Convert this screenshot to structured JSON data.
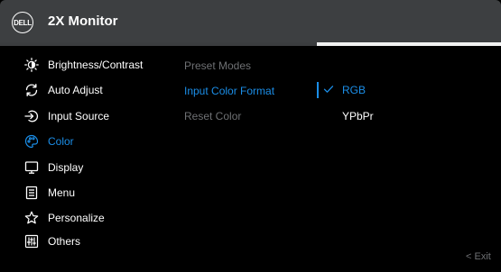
{
  "header": {
    "brand": "DELL",
    "title": "2X Monitor",
    "progress": 0.632
  },
  "menu": {
    "items": [
      {
        "label": "Brightness/Contrast",
        "icon": "brightness-icon"
      },
      {
        "label": "Auto Adjust",
        "icon": "auto-adjust-icon"
      },
      {
        "label": "Input Source",
        "icon": "input-source-icon"
      },
      {
        "label": "Color",
        "icon": "color-icon",
        "active": true
      },
      {
        "label": "Display",
        "icon": "display-icon"
      },
      {
        "label": "Menu",
        "icon": "menu-icon"
      },
      {
        "label": "Personalize",
        "icon": "star-icon"
      },
      {
        "label": "Others",
        "icon": "others-icon"
      }
    ]
  },
  "submenu": {
    "items": [
      {
        "label": "Preset Modes"
      },
      {
        "label": "Input Color Format",
        "active": true
      },
      {
        "label": "Reset Color"
      }
    ]
  },
  "options": {
    "items": [
      {
        "label": "RGB",
        "selected": true
      },
      {
        "label": "YPbPr"
      }
    ]
  },
  "footer": {
    "exit_label": "< Exit"
  },
  "colors": {
    "accent": "#1b8ee8",
    "header_bg": "#3d3f41",
    "dim_text": "#6e7073",
    "background": "#000000"
  }
}
